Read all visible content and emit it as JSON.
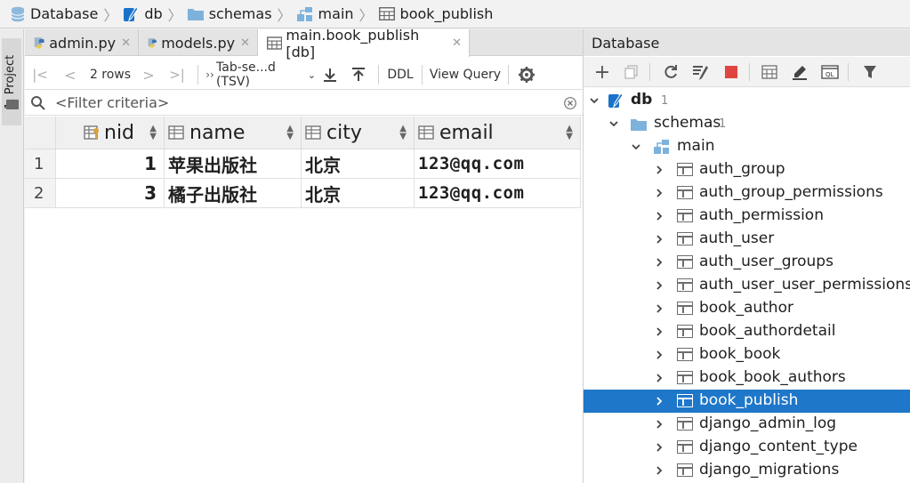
{
  "breadcrumb": {
    "items": [
      "Database",
      "db",
      "schemas",
      "main",
      "book_publish"
    ]
  },
  "sidebar": {
    "project_label": "1: Project",
    "bottom_label": "s"
  },
  "editor_tabs": [
    {
      "label": "admin.py"
    },
    {
      "label": "models.py"
    },
    {
      "label": "main.book_publish [db]"
    }
  ],
  "toolbar": {
    "rows_label": "2 rows",
    "format_label": "Tab-se...d (TSV)",
    "ddl_label": "DDL",
    "view_query_label": "View Query"
  },
  "filter": {
    "placeholder": "<Filter criteria>"
  },
  "grid": {
    "columns": [
      "nid",
      "name",
      "city",
      "email"
    ],
    "rows": [
      {
        "num": "1",
        "nid": "1",
        "name": "苹果出版社",
        "city": "北京",
        "email": "123@qq.com"
      },
      {
        "num": "2",
        "nid": "3",
        "name": "橘子出版社",
        "city": "北京",
        "email": "123@qq.com"
      }
    ]
  },
  "database_panel": {
    "title": "Database",
    "root": {
      "label": "db",
      "count": "1"
    },
    "schemas": {
      "label": "schemas",
      "count": "1"
    },
    "main": {
      "label": "main"
    },
    "tables": [
      "auth_group",
      "auth_group_permissions",
      "auth_permission",
      "auth_user",
      "auth_user_groups",
      "auth_user_user_permissions",
      "book_author",
      "book_authordetail",
      "book_book",
      "book_book_authors",
      "book_publish",
      "django_admin_log",
      "django_content_type",
      "django_migrations"
    ],
    "selected_table": "book_publish"
  },
  "colors": {
    "selection": "#1f77c9",
    "stop_red": "#e0443e",
    "db_blue": "#1a73c8"
  }
}
